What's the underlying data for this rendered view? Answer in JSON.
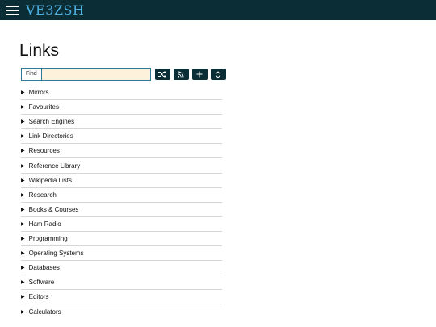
{
  "header": {
    "brand": "VE3ZSH",
    "menu_icon": "hamburger-menu-icon",
    "background": "#0b2d36",
    "brand_color": "#4eb0e3"
  },
  "page": {
    "title": "Links"
  },
  "search": {
    "label": "Find",
    "value": "",
    "placeholder": "",
    "input_background": "#fdf1dc"
  },
  "toolbar": {
    "buttons": [
      {
        "icon": "shuffle-icon"
      },
      {
        "icon": "rss-feed-icon"
      },
      {
        "icon": "plus-icon"
      },
      {
        "icon": "expand-collapse-icon"
      }
    ]
  },
  "sections": [
    {
      "label": "Mirrors"
    },
    {
      "label": "Favourites"
    },
    {
      "label": "Search Engines"
    },
    {
      "label": "Link Directories"
    },
    {
      "label": "Resources"
    },
    {
      "label": "Reference Library"
    },
    {
      "label": "Wikipedia Lists"
    },
    {
      "label": "Research"
    },
    {
      "label": "Books & Courses"
    },
    {
      "label": "Ham Radio"
    },
    {
      "label": "Programming"
    },
    {
      "label": "Operating Systems"
    },
    {
      "label": "Databases"
    },
    {
      "label": "Software"
    },
    {
      "label": "Editors"
    },
    {
      "label": "Calculators"
    }
  ]
}
